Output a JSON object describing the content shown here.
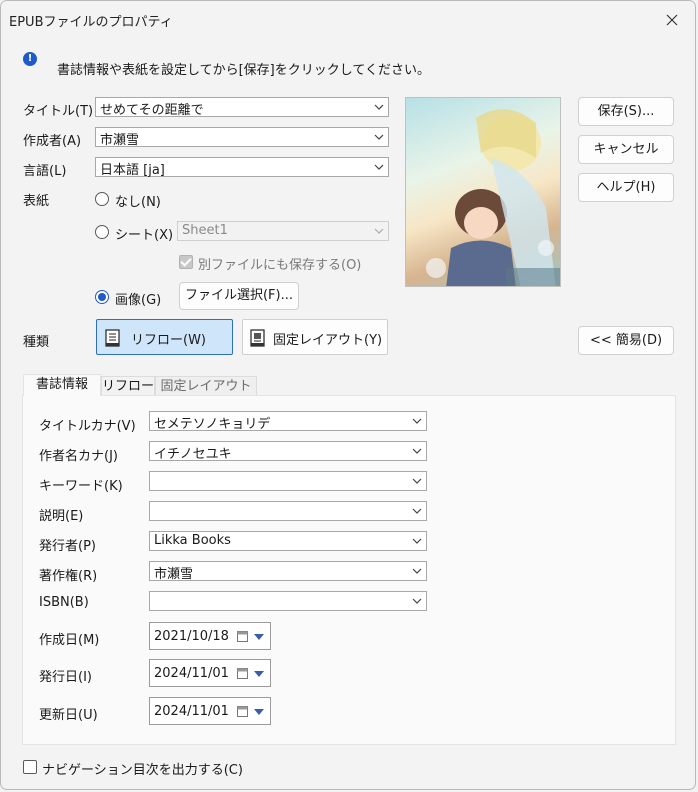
{
  "window": {
    "title": "EPUBファイルのプロパティ"
  },
  "info": {
    "message": "書誌情報や表紙を設定してから[保存]をクリックしてください。"
  },
  "fields": {
    "title_label": "タイトル(T)",
    "title_value": "せめてその距離で",
    "author_label": "作成者(A)",
    "author_value": "市瀬雪",
    "language_label": "言語(L)",
    "language_value": "日本語 [ja]"
  },
  "cover": {
    "label": "表紙",
    "none_label": "なし(N)",
    "sheet_label": "シート(X)",
    "sheet_value": "Sheet1",
    "save_separate_label": "別ファイルにも保存する(O)",
    "image_label": "画像(G)",
    "select_file_label": "ファイル選択(F)...",
    "selected": "image"
  },
  "buttons": {
    "save": "保存(S)...",
    "cancel": "キャンセル",
    "help": "ヘルプ(H)",
    "simple": "<< 簡易(D)"
  },
  "kind": {
    "label": "種類",
    "reflow": "リフロー(W)",
    "fixed": "固定レイアウト(Y)",
    "selected": "reflow"
  },
  "tabs": [
    {
      "label": "書誌情報",
      "active": true
    },
    {
      "label": "リフロー",
      "active": false
    },
    {
      "label": "固定レイアウト",
      "active": false
    }
  ],
  "biblio": {
    "rows": [
      {
        "label": "タイトルカナ(V)",
        "value": "セメテソノキョリデ"
      },
      {
        "label": "作者名カナ(J)",
        "value": "イチノセユキ"
      },
      {
        "label": "キーワード(K)",
        "value": ""
      },
      {
        "label": "説明(E)",
        "value": ""
      },
      {
        "label": "発行者(P)",
        "value": "Likka Books"
      },
      {
        "label": "著作権(R)",
        "value": "市瀬雪"
      },
      {
        "label": "ISBN(B)",
        "value": ""
      }
    ],
    "dates": [
      {
        "label": "作成日(M)",
        "value": "2021/10/18"
      },
      {
        "label": "発行日(I)",
        "value": "2024/11/01"
      },
      {
        "label": "更新日(U)",
        "value": "2024/11/01"
      }
    ]
  },
  "footer": {
    "nav_label": "ナビゲーション目次を出力する(C)",
    "nav_checked": false
  }
}
